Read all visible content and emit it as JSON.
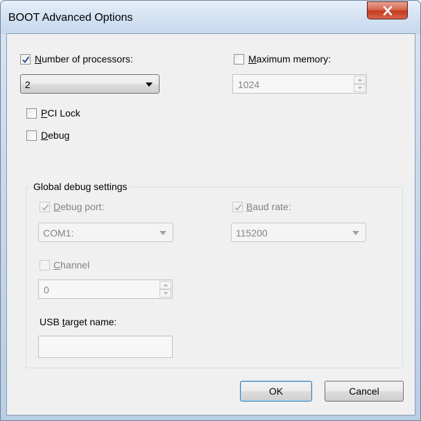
{
  "window": {
    "title": "BOOT Advanced Options",
    "close_label": "X"
  },
  "processors": {
    "checkbox_label_accel": "N",
    "checkbox_label_rest": "umber of processors:",
    "checked": true,
    "combo_value": "2"
  },
  "max_memory": {
    "label_accel": "M",
    "label_rest": "aximum memory:",
    "checked": false,
    "value": "1024"
  },
  "pci_lock": {
    "label_accel": "P",
    "label_rest": "CI Lock",
    "checked": false
  },
  "debug": {
    "label_accel": "D",
    "label_rest": "ebug",
    "checked": false
  },
  "global_debug": {
    "title": "Global debug settings",
    "debug_port": {
      "label_accel": "D",
      "label_rest": "ebug port:",
      "checked": true,
      "value": "COM1:"
    },
    "baud_rate": {
      "label_accel": "B",
      "label_rest": "aud rate:",
      "checked": true,
      "value": "115200"
    },
    "channel": {
      "label_accel": "C",
      "label_rest": "hannel",
      "checked": false,
      "value": "0"
    },
    "usb_target": {
      "label_pre": "USB ",
      "label_accel": "t",
      "label_rest": "arget name:",
      "value": ""
    }
  },
  "buttons": {
    "ok": "OK",
    "cancel": "Cancel"
  },
  "colors": {
    "close_button": "#c43b1f",
    "default_button_border": "#3c7fb1",
    "disabled_text": "#838383"
  }
}
